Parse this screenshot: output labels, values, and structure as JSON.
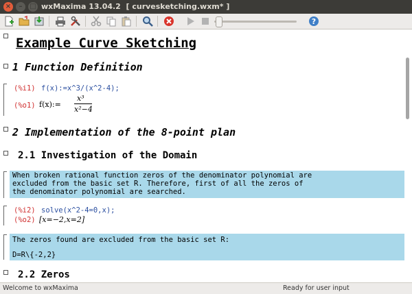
{
  "window": {
    "title": "wxMaxima 13.04.2  [ curvesketching.wxm* ]"
  },
  "toolbar": {
    "icons": [
      "new-document-icon",
      "open-folder-icon",
      "save-icon",
      "print-icon",
      "preferences-icon",
      "cut-icon",
      "copy-icon",
      "paste-icon",
      "find-icon",
      "interrupt-icon",
      "play-icon",
      "stop-icon",
      "help-icon"
    ]
  },
  "document": {
    "title": "Example Curve Sketching",
    "section1": "1 Function Definition",
    "cell1": {
      "in_label": "(%i1)",
      "in_text": "f(x):=x^3/(x^2-4);",
      "out_label": "(%o1)",
      "out_lhs": "f(x):=",
      "out_num": "x³",
      "out_den": "x²−4"
    },
    "section2": "2 Implementation of the 8-point plan",
    "subsection21": "2.1 Investigation of the Domain",
    "text1": [
      "When broken rational function zeros of the denominator polynomial are",
      "excluded from the basic set R. Therefore, first of all the zeros of",
      "the denominator polynomial are searched."
    ],
    "cell2": {
      "in_label": "(%i2)",
      "in_text": "solve(x^2-4=0,x);",
      "out_label": "(%o2)",
      "out_text": "[x=−2,x=2]"
    },
    "text2": [
      "The zeros found are excluded from the basic set R:",
      "",
      "D=R\\{-2,2}"
    ],
    "subsection22": "2.2 Zeros"
  },
  "status": {
    "left": "Welcome to wxMaxima",
    "right": "Ready for user input"
  }
}
